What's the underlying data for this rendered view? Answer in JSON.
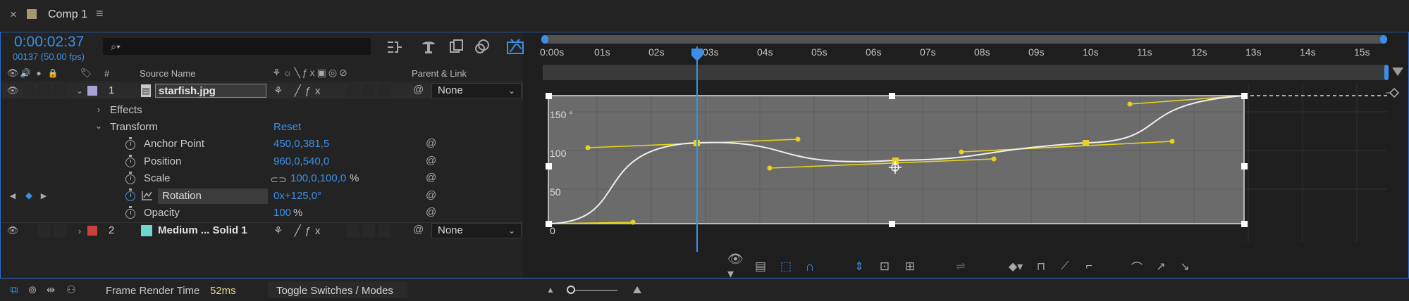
{
  "tab": {
    "close": "×",
    "title": "Comp 1",
    "menu": "≡"
  },
  "timecode": "0:00:02:37",
  "frames": "00137 (50.00 fps)",
  "search": {
    "placeholder": "",
    "icon": "search-icon"
  },
  "columns": {
    "num": "#",
    "source_name": "Source Name",
    "parent_link": "Parent & Link"
  },
  "layers": [
    {
      "num": "1",
      "name": "starfish.jpg",
      "color": "#a8a3d6",
      "parent": "None"
    },
    {
      "num": "2",
      "name": "Medium ... Solid 1",
      "color": "#c9403f",
      "parent": "None"
    }
  ],
  "groups": {
    "effects": "Effects",
    "transform": "Transform",
    "reset": "Reset"
  },
  "properties": [
    {
      "name": "Anchor Point",
      "value": "450,0,381,5"
    },
    {
      "name": "Position",
      "value": "960,0,540,0"
    },
    {
      "name": "Scale",
      "value": "100,0,100,0",
      "unit": "%"
    },
    {
      "name": "Rotation",
      "value": "0x+125,0°"
    },
    {
      "name": "Opacity",
      "value": "100",
      "unit": "%"
    }
  ],
  "ruler": [
    "0:00s",
    "01s",
    "02s",
    "03s",
    "04s",
    "05s",
    "06s",
    "07s",
    "08s",
    "09s",
    "10s",
    "11s",
    "12s",
    "13s",
    "14s",
    "15s"
  ],
  "graph_labels": [
    "150 °",
    "100",
    "50",
    "0"
  ],
  "bottom": {
    "frame_render_label": "Frame Render Time",
    "frame_render_value": "52ms",
    "toggle": "Toggle Switches / Modes"
  },
  "colors": {
    "accent": "#3d8fe6",
    "keyframe": "#e8d21d",
    "graph_bg": "#6b6b6b",
    "panel_border": "#2d6fd6"
  }
}
